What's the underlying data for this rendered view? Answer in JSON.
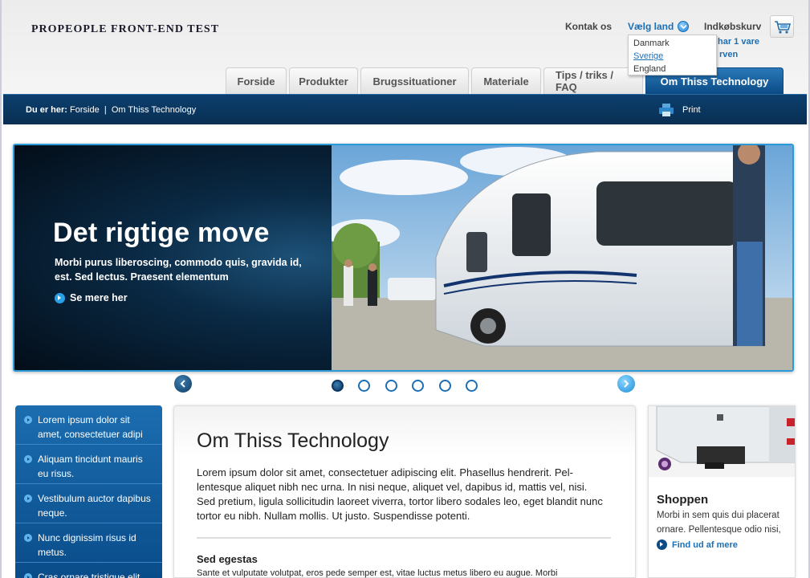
{
  "header": {
    "logo": "PROPEOPLE FRONT-END TEST",
    "contact": "Kontak os",
    "choose_country": "Vælg land",
    "cart": "Indkøbskurv",
    "cart_status_line1": "har 1 vare",
    "cart_status_line2": "rven"
  },
  "country_dropdown": {
    "options": [
      "Danmark",
      "Sverige",
      "England"
    ],
    "highlighted": "Sverige"
  },
  "tabs": [
    {
      "label": "Forside"
    },
    {
      "label": "Produkter"
    },
    {
      "label": "Brugssituationer"
    },
    {
      "label": "Materiale"
    },
    {
      "label": "Tips / triks / FAQ"
    },
    {
      "label": "Om Thiss Technology",
      "active": true
    }
  ],
  "breadcrumb": {
    "prefix": "Du er her:",
    "items": [
      "Forside",
      "Om Thiss Technology"
    ],
    "separator": "|",
    "print": "Print"
  },
  "hero": {
    "title": "Det rigtige move",
    "text": "Morbi purus liberoscing, commodo quis, gravida id, est. Sed lectus. Praesent elementum",
    "link": "Se mere her",
    "slide_count": 6,
    "active_slide": 1
  },
  "left_nav": [
    "Lorem ipsum dolor sit amet, consectetuer adipi",
    "Aliquam tincidunt mauris eu risus.",
    "Vestibulum auctor dapibus neque.",
    "Nunc dignissim risus id metus.",
    "Cras ornare tristique elit."
  ],
  "main": {
    "title": "Om Thiss Technology",
    "body": "Lorem ipsum dolor sit amet, consectetuer adipiscing elit. Phasellus hendrerit. Pel­lentesque aliquet nibh nec urna. In nisi neque, aliquet vel, dapibus id, mattis vel, nisi. Sed pretium, ligula sollicitudin laoreet viverra, tortor libero sodales leo, eget blandit nunc tortor eu nibh. Nullam mollis. Ut justo. Suspendisse potenti.",
    "subheading": "Sed egestas",
    "subtext": "Sante et vulputate volutpat, eros pede semper est, vitae luctus metus libero eu augue. Morbi"
  },
  "shop": {
    "title": "Shoppen",
    "text": "Morbi in sem quis dui placerat ornare. Pellentesque odio nisi,",
    "link": "Find ud af mere"
  },
  "colors": {
    "accent": "#1c6fb5",
    "nav_dark": "#0b4b86",
    "hero_border": "#2a9ad8"
  }
}
